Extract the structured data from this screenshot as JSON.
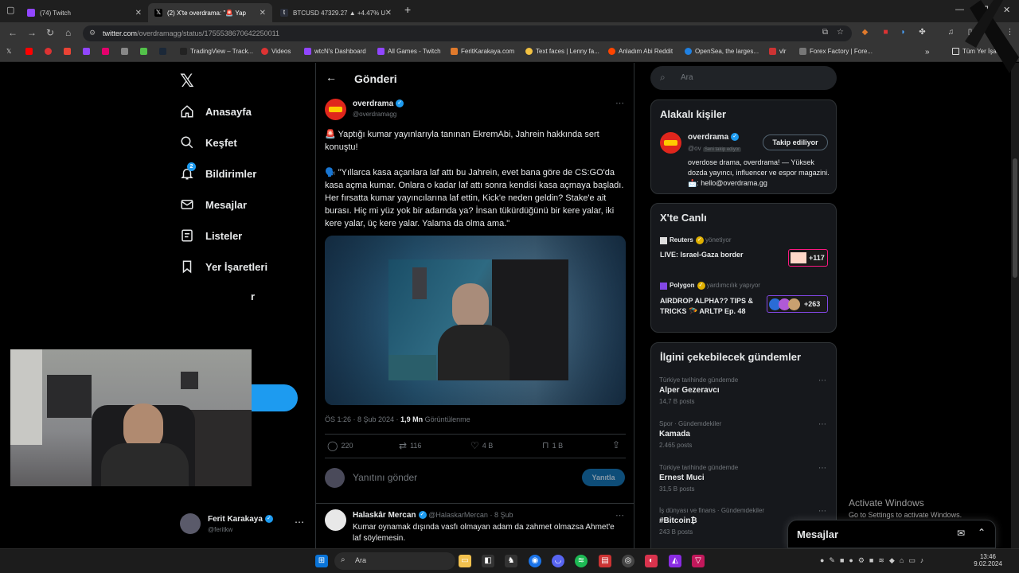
{
  "tabs": [
    {
      "label": "(74) Twitch",
      "color": "#9146ff"
    },
    {
      "label": "(2) X'te overdrama: \"🚨 Yap",
      "color": "#000000"
    },
    {
      "label": "BTCUSD 47329.27 ▲ +4.47% U",
      "color": "#131722"
    }
  ],
  "address": {
    "host": "twitter.com",
    "path": "/overdramagg/status/1755538670642250011"
  },
  "bookmarks": [
    "TradingView – Track...",
    "Videos",
    "wtcN's Dashboard",
    "All Games - Twitch",
    "FeritKarakaya.com",
    "Text faces | Lenny fa...",
    "Anladım Abi Reddit",
    "OpenSea, the larges...",
    "vlr",
    "Forex Factory | Fore...",
    "Tüm Yer İşaretleri"
  ],
  "nav": [
    {
      "label": "Anasayfa",
      "icon": "home-icon"
    },
    {
      "label": "Keşfet",
      "icon": "search-icon"
    },
    {
      "label": "Bildirimler",
      "icon": "bell-icon",
      "badge": "2"
    },
    {
      "label": "Mesajlar",
      "icon": "mail-icon"
    },
    {
      "label": "Listeler",
      "icon": "list-icon"
    },
    {
      "label": "Yer İşaretleri",
      "icon": "bookmark-icon"
    }
  ],
  "nav_partial": "r",
  "profile": {
    "name": "Ferit Karakaya",
    "handle": "@feritkw"
  },
  "header": {
    "title": "Gönderi"
  },
  "post": {
    "author": "overdrama",
    "handle": "@overdramagg",
    "line1": "🚨 Yaptığı kumar yayınlarıyla tanınan EkremAbi, Jahrein hakkında sert konuştu!",
    "line2": "🗣️ \"Yıllarca kasa açanlara laf attı bu Jahrein, evet bana göre de CS:GO'da kasa açma kumar. Onlara o kadar laf attı sonra kendisi kasa açmaya başladı. Her fırsatta kumar yayıncılarına laf ettin, Kick'e neden geldin? Stake'e ait burası. Hiç mi yüz yok bir adamda ya? İnsan tükürdüğünü bir kere yalar, iki kere yalar, üç kere yalar. Yalama da olma ama.\"",
    "time": "ÖS 1:26 · 8 Şub 2024 · ",
    "views": "1,9 Mn",
    "views_label": " Görüntülenme",
    "replies": "220",
    "reposts": "116",
    "likes": "4 B",
    "bookmarks": "1 B"
  },
  "reply_box": {
    "placeholder": "Yanıtını gönder",
    "button": "Yanıtla"
  },
  "reply": {
    "author": "Halaskâr Mercan",
    "handle": "@HalaskarMercan · 8 Şub",
    "text": "Kumar oynamak dışında vasfı olmayan adam da zahmet olmazsa Ahmet'e laf söylemesin."
  },
  "search": {
    "placeholder": "Ara"
  },
  "related": {
    "title": "Alakalı kişiler",
    "name": "overdrama",
    "handle": "@ov",
    "follows_you": "Seni takip ediyor",
    "button": "Takip ediliyor",
    "bio": "overdose drama, overdrama! — Yüksek dozda yayıncı, influencer ve espor magazini. 📩: hello@overdrama.gg"
  },
  "live": {
    "title": "X'te Canlı",
    "items": [
      {
        "host": "Reuters",
        "role": "yönetiyor",
        "title": "LIVE: Israel-Gaza border",
        "count": "+117"
      },
      {
        "host": "Polygon",
        "role": "yardımcılık yapıyor",
        "title": "AIRDROP ALPHA?? TIPS & TRICKS 🪂 ARLTP Ep. 48",
        "count": "+263"
      }
    ]
  },
  "trends": {
    "title": "İlgini çekebilecek gündemler",
    "items": [
      {
        "cat": "Türkiye tarihinde gündemde",
        "name": "Alper Gezeravcı",
        "count": "14,7 B posts"
      },
      {
        "cat": "Spor · Gündemdekiler",
        "name": "Kamada",
        "count": "2.465 posts"
      },
      {
        "cat": "Türkiye tarihinde gündemde",
        "name": "Ernest Muci",
        "count": "31,5 B posts"
      },
      {
        "cat": "İş dünyası ve finans · Gündemdekiler",
        "name": "#Bitcoin₿",
        "count": "243 B posts"
      }
    ]
  },
  "messages": {
    "title": "Mesajlar"
  },
  "watermark": {
    "line1": "Activate Windows",
    "line2": "Go to Settings to activate Windows."
  },
  "taskbar": {
    "search": "Ara",
    "time": "13:46",
    "date": "9.02.2024"
  }
}
